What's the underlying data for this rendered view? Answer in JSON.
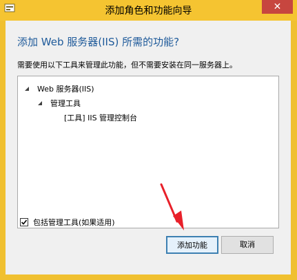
{
  "window": {
    "title": "添加角色和功能向导",
    "close_label": "✕"
  },
  "dialog": {
    "heading": "添加 Web 服务器(IIS) 所需的功能?",
    "description": "需要使用以下工具来管理此功能，但不需要安装在同一服务器上。"
  },
  "tree": {
    "items": [
      {
        "label": "Web 服务器(IIS)",
        "expanded": true
      },
      {
        "label": "管理工具",
        "expanded": true
      },
      {
        "label": "[工具] IIS 管理控制台",
        "expanded": false
      }
    ]
  },
  "options": {
    "include_tools_label": "包括管理工具(如果适用)",
    "include_tools_checked": true
  },
  "buttons": {
    "add_label": "添加功能",
    "cancel_label": "取消"
  },
  "colors": {
    "titlebar": "#f5c431",
    "close": "#c7463f",
    "heading": "#1e5a9a",
    "annotation_arrow": "#e8202a"
  }
}
